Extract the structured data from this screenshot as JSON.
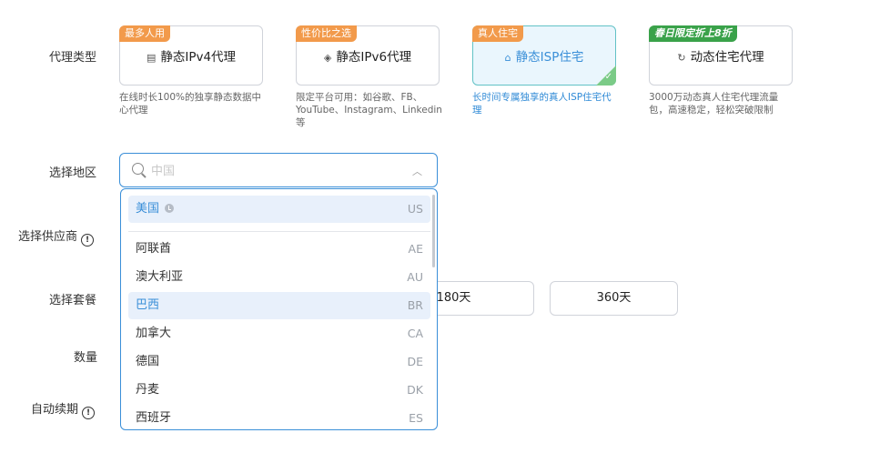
{
  "labels": {
    "proxy_type": "代理类型",
    "region": "选择地区",
    "provider": "选择供应商",
    "package": "选择套餐",
    "quantity": "数量",
    "auto_renew": "自动续期"
  },
  "proxy_types": [
    {
      "badge": "最多人用",
      "icon": "server-icon",
      "glyph": "▤",
      "title": "静态IPv4代理",
      "desc": "在线时长100%的独享静态数据中心代理"
    },
    {
      "badge": "性价比之选",
      "icon": "layers-icon",
      "glyph": "◈",
      "title": "静态IPv6代理",
      "desc": "限定平台可用：如谷歌、FB、YouTube、Instagram、Linkedin等"
    },
    {
      "badge": "真人住宅",
      "icon": "home-icon",
      "glyph": "⌂",
      "title": "静态ISP住宅",
      "desc": "长时间专属独享的真人ISP住宅代理",
      "selected": true
    },
    {
      "badge": "春日限定折上8折",
      "icon": "refresh-icon",
      "glyph": "↻",
      "title": "动态住宅代理",
      "desc": "3000万动态真人住宅代理流量包，高速稳定，轻松突破限制"
    }
  ],
  "region_search": {
    "placeholder": "中国",
    "value": ""
  },
  "region_options": [
    {
      "name": "美国",
      "code": "US",
      "recent": true
    },
    {
      "name": "阿联酋",
      "code": "AE"
    },
    {
      "name": "澳大利亚",
      "code": "AU"
    },
    {
      "name": "巴西",
      "code": "BR"
    },
    {
      "name": "加拿大",
      "code": "CA"
    },
    {
      "name": "德国",
      "code": "DE"
    },
    {
      "name": "丹麦",
      "code": "DK"
    },
    {
      "name": "西班牙",
      "code": "ES"
    }
  ],
  "packages": [
    "180天",
    "360天"
  ],
  "colors": {
    "accent": "#3a8fd8",
    "badge_orange": "#f29a4b",
    "badge_green": "#3aa24a"
  }
}
